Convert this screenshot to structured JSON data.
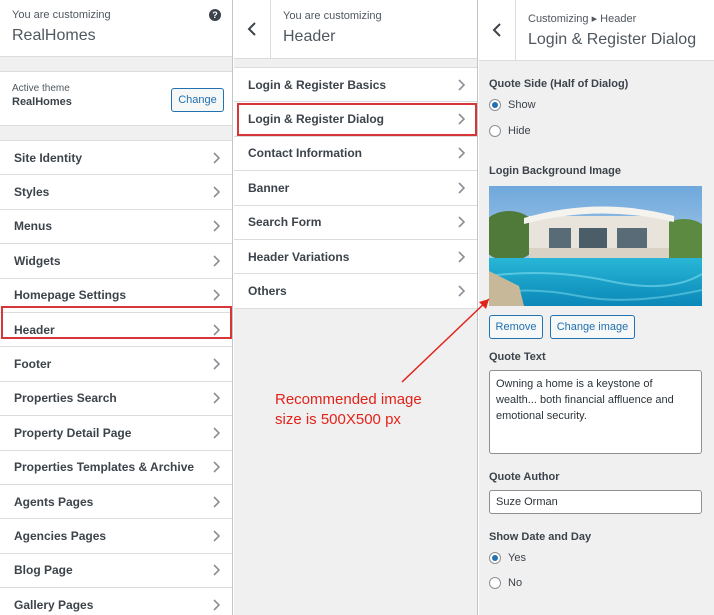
{
  "panel1": {
    "customizing_label": "You are customizing",
    "site_title": "RealHomes",
    "active_theme_label": "Active theme",
    "theme_name": "RealHomes",
    "change_button": "Change",
    "items": [
      {
        "label": "Site Identity"
      },
      {
        "label": "Styles"
      },
      {
        "label": "Menus"
      },
      {
        "label": "Widgets"
      },
      {
        "label": "Homepage Settings"
      },
      {
        "label": "Header"
      },
      {
        "label": "Footer"
      },
      {
        "label": "Properties Search"
      },
      {
        "label": "Property Detail Page"
      },
      {
        "label": "Properties Templates & Archive"
      },
      {
        "label": "Agents Pages"
      },
      {
        "label": "Agencies Pages"
      },
      {
        "label": "Blog Page"
      },
      {
        "label": "Gallery Pages"
      }
    ]
  },
  "panel2": {
    "customizing_label": "You are customizing",
    "section_title": "Header",
    "items": [
      {
        "label": "Login & Register Basics"
      },
      {
        "label": "Login & Register Dialog"
      },
      {
        "label": "Contact Information"
      },
      {
        "label": "Banner"
      },
      {
        "label": "Search Form"
      },
      {
        "label": "Header Variations"
      },
      {
        "label": "Others"
      }
    ]
  },
  "panel3": {
    "breadcrumb": "Customizing ▸ Header",
    "section_title": "Login & Register Dialog",
    "quote_side": {
      "title": "Quote Side (Half of Dialog)",
      "options": [
        "Show",
        "Hide"
      ],
      "selected": "Show"
    },
    "login_bg": {
      "title": "Login Background Image",
      "remove_button": "Remove",
      "change_button": "Change image"
    },
    "quote_text": {
      "title": "Quote Text",
      "value": "Owning a home is a keystone of wealth... both financial affluence and emotional security."
    },
    "quote_author": {
      "title": "Quote Author",
      "value": "Suze Orman"
    },
    "show_date": {
      "title": "Show Date and Day",
      "options": [
        "Yes",
        "No"
      ],
      "selected": "Yes"
    }
  },
  "annotation": {
    "line1": "Recommended image",
    "line2": "size is 500X500 px",
    "color": "#e2231a"
  },
  "colors": {
    "accent": "#2271b1",
    "highlight": "#d63638",
    "panel_bg": "#f0f0f1"
  }
}
